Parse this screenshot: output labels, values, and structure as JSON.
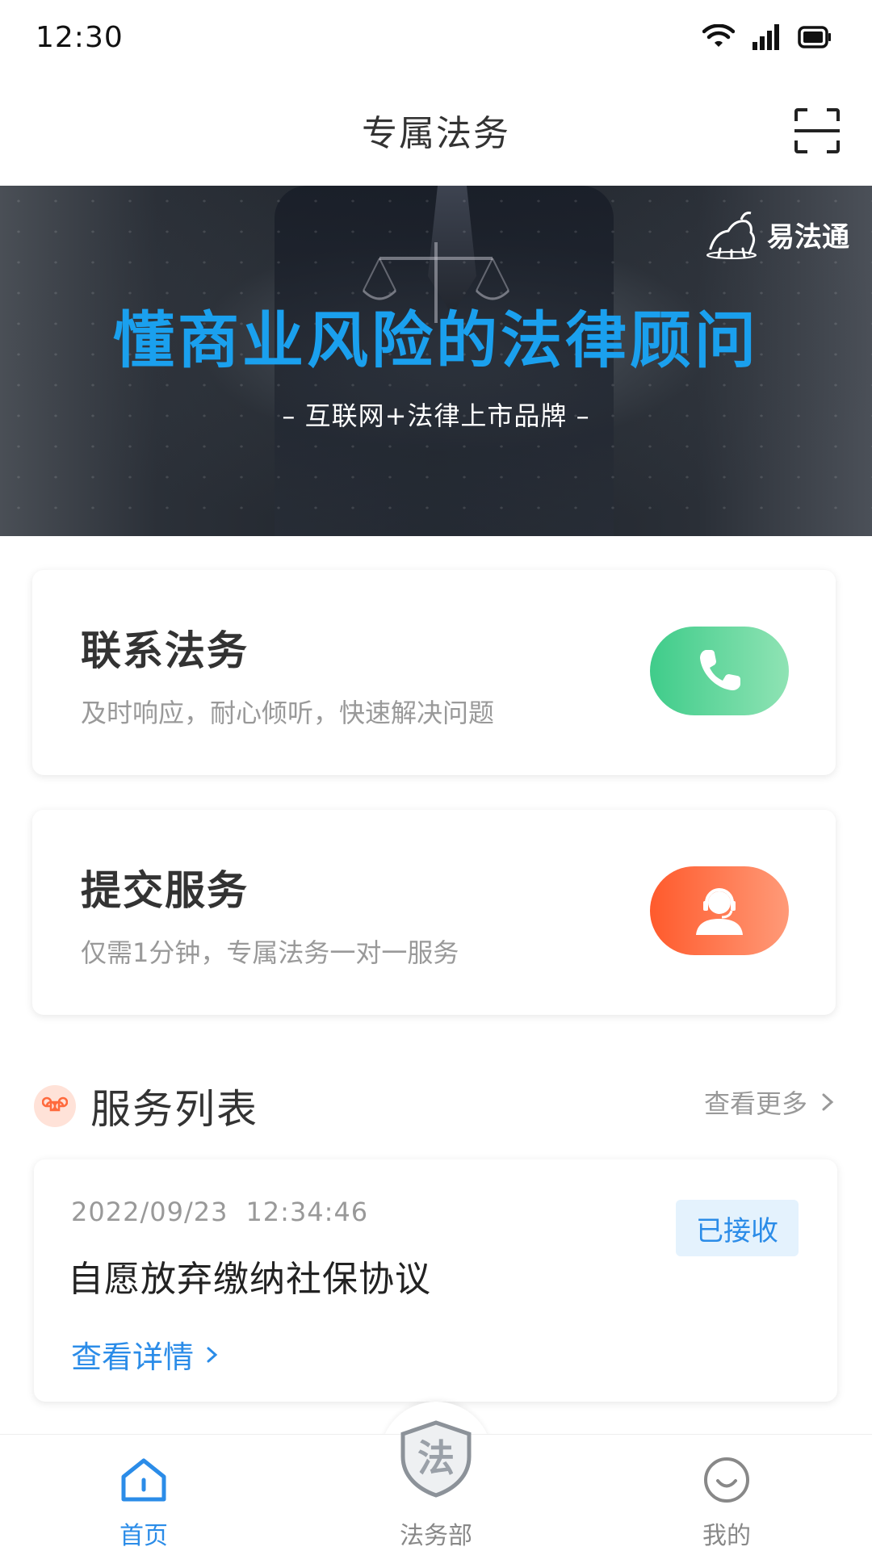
{
  "status_bar": {
    "time": "12:30"
  },
  "header": {
    "title": "专属法务"
  },
  "banner": {
    "logo_text": "易法通",
    "headline": "懂商业风险的法律顾问",
    "subline": "– 互联网+法律上市品牌 –"
  },
  "cards": [
    {
      "title": "联系法务",
      "subtitle": "及时响应，耐心倾听，快速解决问题",
      "button_icon": "phone-icon",
      "button_color": "#3fcc8a"
    },
    {
      "title": "提交服务",
      "subtitle": "仅需1分钟，专属法务一对一服务",
      "button_icon": "customer-service-icon",
      "button_color": "#ff5a2c"
    }
  ],
  "service_list": {
    "title": "服务列表",
    "more_label": "查看更多",
    "items": [
      {
        "date": "2022/09/23",
        "time": "12:34:46",
        "title": "自愿放弃缴纳社保协议",
        "status": "已接收",
        "details_label": "查看详情"
      }
    ]
  },
  "tab_bar": {
    "tabs": [
      {
        "label": "首页",
        "icon": "home-icon",
        "active": true
      },
      {
        "label": "法务部",
        "icon": "shield-law-icon",
        "active": false
      },
      {
        "label": "我的",
        "icon": "smiley-icon",
        "active": false
      }
    ],
    "center_shield_text": "法"
  },
  "colors": {
    "accent": "#2b8ce8",
    "headline_blue": "#1aa0ee",
    "green": "#3fcc8a",
    "orange": "#ff5a2c"
  }
}
